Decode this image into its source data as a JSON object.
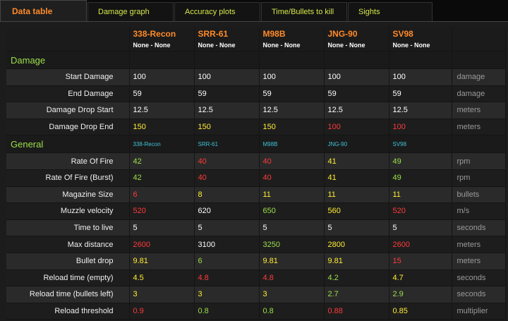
{
  "tabs": [
    {
      "label": "Data table",
      "active": true
    },
    {
      "label": "Damage graph"
    },
    {
      "label": "Accuracy plots"
    },
    {
      "label": "Time/Bullets to kill"
    },
    {
      "label": "Sights"
    }
  ],
  "weapons": [
    {
      "name": "338-Recon",
      "attachments": "None - None",
      "mini": "338-Recon"
    },
    {
      "name": "SRR-61",
      "attachments": "None - None",
      "mini": "SRR-61"
    },
    {
      "name": "M98B",
      "attachments": "None - None",
      "mini": "M98B"
    },
    {
      "name": "JNG-90",
      "attachments": "None - None",
      "mini": "JNG-90"
    },
    {
      "name": "SV98",
      "attachments": "None - None",
      "mini": "SV98"
    }
  ],
  "colors": {
    "w": "#ffffff",
    "y": "#ffee33",
    "r": "#ff3a3a",
    "g": "#9be04a"
  },
  "sections": [
    {
      "title": "Damage",
      "rows": [
        {
          "label": "Start Damage",
          "unit": "damage",
          "values": [
            "100",
            "100",
            "100",
            "100",
            "100"
          ],
          "colors": [
            "w",
            "w",
            "w",
            "w",
            "w"
          ]
        },
        {
          "label": "End Damage",
          "unit": "damage",
          "values": [
            "59",
            "59",
            "59",
            "59",
            "59"
          ],
          "colors": [
            "w",
            "w",
            "w",
            "w",
            "w"
          ]
        },
        {
          "label": "Damage Drop Start",
          "unit": "meters",
          "values": [
            "12.5",
            "12.5",
            "12.5",
            "12.5",
            "12.5"
          ],
          "colors": [
            "w",
            "w",
            "w",
            "w",
            "w"
          ]
        },
        {
          "label": "Damage Drop End",
          "unit": "meters",
          "values": [
            "150",
            "150",
            "150",
            "100",
            "100"
          ],
          "colors": [
            "y",
            "y",
            "y",
            "r",
            "r"
          ]
        }
      ]
    },
    {
      "title": "General",
      "mini": true,
      "rows": [
        {
          "label": "Rate Of Fire",
          "unit": "rpm",
          "values": [
            "42",
            "40",
            "40",
            "41",
            "49"
          ],
          "colors": [
            "g",
            "r",
            "r",
            "y",
            "g"
          ]
        },
        {
          "label": "Rate Of Fire (Burst)",
          "unit": "rpm",
          "values": [
            "42",
            "40",
            "40",
            "41",
            "49"
          ],
          "colors": [
            "g",
            "r",
            "r",
            "y",
            "g"
          ]
        },
        {
          "label": "Magazine Size",
          "unit": "bullets",
          "values": [
            "6",
            "8",
            "11",
            "11",
            "11"
          ],
          "colors": [
            "r",
            "y",
            "y",
            "y",
            "y"
          ]
        },
        {
          "label": "Muzzle velocity",
          "unit": "m/s",
          "values": [
            "520",
            "620",
            "650",
            "560",
            "520"
          ],
          "colors": [
            "r",
            "w",
            "g",
            "y",
            "r"
          ]
        },
        {
          "label": "Time to live",
          "unit": "seconds",
          "values": [
            "5",
            "5",
            "5",
            "5",
            "5"
          ],
          "colors": [
            "w",
            "w",
            "w",
            "w",
            "w"
          ]
        },
        {
          "label": "Max distance",
          "unit": "meters",
          "values": [
            "2600",
            "3100",
            "3250",
            "2800",
            "2600"
          ],
          "colors": [
            "r",
            "w",
            "g",
            "y",
            "r"
          ]
        },
        {
          "label": "Bullet drop",
          "unit": "meters",
          "values": [
            "9.81",
            "6",
            "9.81",
            "9.81",
            "15"
          ],
          "colors": [
            "y",
            "g",
            "y",
            "y",
            "r"
          ]
        },
        {
          "label": "Reload time (empty)",
          "unit": "seconds",
          "values": [
            "4.5",
            "4.8",
            "4.8",
            "4.2",
            "4.7"
          ],
          "colors": [
            "y",
            "r",
            "r",
            "g",
            "y"
          ]
        },
        {
          "label": "Reload time (bullets left)",
          "unit": "seconds",
          "values": [
            "3",
            "3",
            "3",
            "2.7",
            "2.9"
          ],
          "colors": [
            "y",
            "y",
            "y",
            "g",
            "g"
          ]
        },
        {
          "label": "Reload threshold",
          "unit": "multiplier",
          "values": [
            "0.9",
            "0.8",
            "0.8",
            "0.88",
            "0.85"
          ],
          "colors": [
            "r",
            "g",
            "g",
            "r",
            "y"
          ]
        }
      ]
    }
  ]
}
